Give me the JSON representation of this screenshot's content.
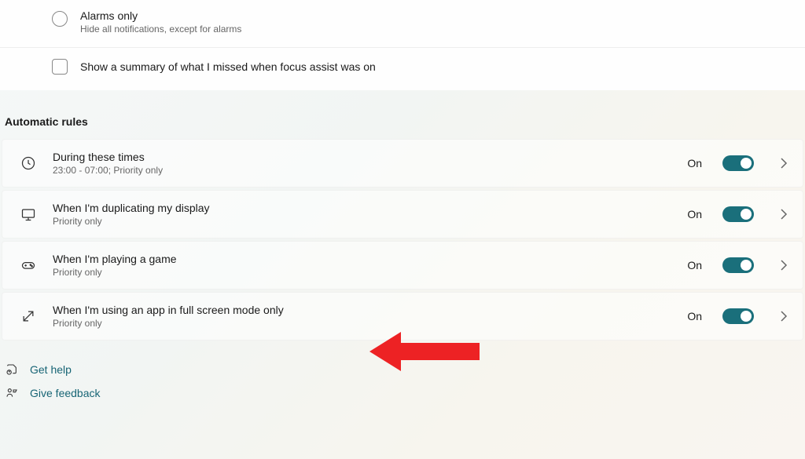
{
  "radio": {
    "title": "Alarms only",
    "desc": "Hide all notifications, except for alarms"
  },
  "checkbox": {
    "label": "Show a summary of what I missed when focus assist was on"
  },
  "section_header": "Automatic rules",
  "rules": [
    {
      "title": "During these times",
      "desc": "23:00 - 07:00; Priority only",
      "state": "On"
    },
    {
      "title": "When I'm duplicating my display",
      "desc": "Priority only",
      "state": "On"
    },
    {
      "title": "When I'm playing a game",
      "desc": "Priority only",
      "state": "On"
    },
    {
      "title": "When I'm using an app in full screen mode only",
      "desc": "Priority only",
      "state": "On"
    }
  ],
  "footer": {
    "help": "Get help",
    "feedback": "Give feedback"
  }
}
